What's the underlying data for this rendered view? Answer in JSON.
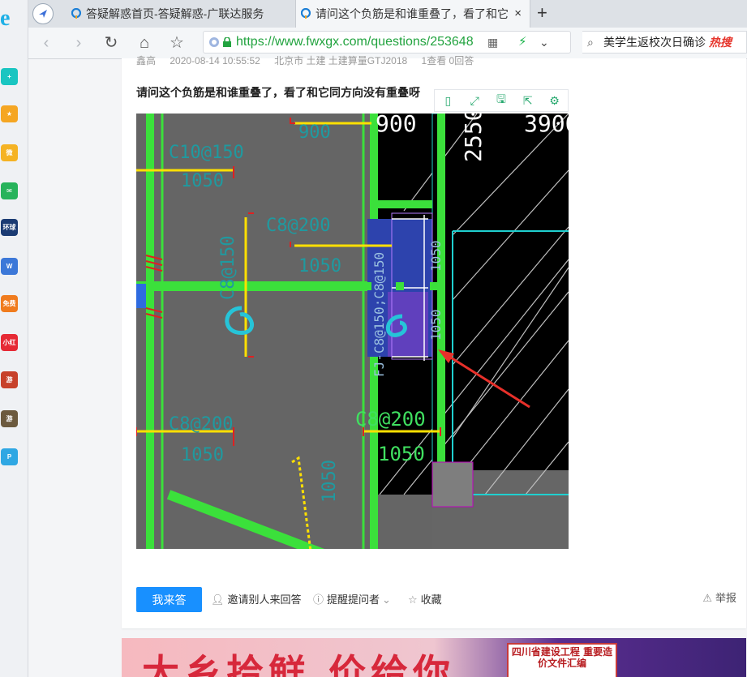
{
  "browser": {
    "tabs": [
      {
        "title": "答疑解惑首页-答疑解惑-广联达服务",
        "active": false
      },
      {
        "title": "请问这个负筋是和谁重叠了，看了和它同方向没有重叠呀",
        "active": true
      }
    ],
    "new_tab_label": "+",
    "close_label": "×",
    "url": "https://www.fwxgx.com/questions/253648",
    "search_text": "美学生返校次日确诊",
    "search_hot": "热搜"
  },
  "sidebar": {
    "logo": "e",
    "apps": [
      {
        "name": "health-app-icon",
        "label": "+",
        "color": "#19c5c1"
      },
      {
        "name": "favorites-icon",
        "label": "★",
        "color": "#f5a623"
      },
      {
        "name": "weibo-icon",
        "label": "微",
        "color": "#f5b324"
      },
      {
        "name": "mail-icon",
        "label": "✉",
        "color": "#27b35b"
      },
      {
        "name": "globe-app-icon",
        "label": "环球网校",
        "color": "#1b3b73"
      },
      {
        "name": "docs-icon",
        "label": "W",
        "color": "#3c78d8"
      },
      {
        "name": "free-novel-icon",
        "label": "免费小说",
        "color": "#f07c1e"
      },
      {
        "name": "red-book-icon",
        "label": "小红书",
        "color": "#e62a35"
      },
      {
        "name": "game-icon-1",
        "label": "游",
        "color": "#c7412a"
      },
      {
        "name": "game-icon-2",
        "label": "游",
        "color": "#6c5a3e"
      },
      {
        "name": "p-app-icon",
        "label": "P",
        "color": "#2fa7e3"
      }
    ]
  },
  "question": {
    "meta": [
      "鑫高",
      "2020-08-14 10:55:52",
      "北京市 土建 土建算量GTJ2018",
      "1查看 0回答"
    ],
    "title": "请问这个负筋是和谁重叠了，看了和它同方向没有重叠呀",
    "image_toolbar": [
      "▯",
      "⤢",
      "🖫",
      "⇱",
      "⚙"
    ],
    "cad_labels": {
      "dims": [
        "900",
        "2550",
        "3900"
      ],
      "top_left": [
        "C10@150",
        "1050"
      ],
      "center_top": [
        "C8@200",
        "1050"
      ],
      "vertical_left": [
        "C8@150"
      ],
      "mid_right": [
        "FJ-C8@150;C8@150",
        "1050",
        "1050"
      ],
      "bottom_left": [
        "C8@200",
        "1050"
      ],
      "bottom_center": [
        "C8@200",
        "1050"
      ],
      "bottom_vert": [
        "1050"
      ]
    }
  },
  "actions": {
    "answer": "我来答",
    "invite": "邀请别人来回答",
    "remind": "提醒提问者",
    "collect": "收藏",
    "report": "举报"
  },
  "banner": {
    "text": "大乡拾鲜 价给你",
    "book_title": "四川省建设工程 重要造价文件汇编"
  }
}
